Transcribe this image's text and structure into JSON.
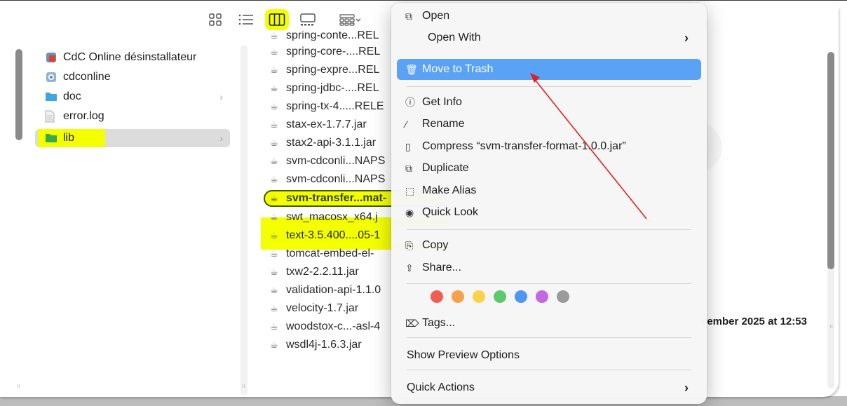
{
  "toolbar": {
    "views": [
      {
        "name": "icon-view",
        "active": false
      },
      {
        "name": "list-view",
        "active": false
      },
      {
        "name": "column-view",
        "active": true
      },
      {
        "name": "gallery-view",
        "active": false
      },
      {
        "name": "group-by",
        "active": false
      }
    ]
  },
  "sidebar": {
    "items": [
      {
        "label": "CdC Online désinstallateur",
        "icon": "app-icon",
        "chevron": false
      },
      {
        "label": "cdconline",
        "icon": "app-icon",
        "chevron": false
      },
      {
        "label": "doc",
        "icon": "folder-icon",
        "chevron": true
      },
      {
        "label": "error.log",
        "icon": "document-icon",
        "chevron": false
      },
      {
        "label": "lib",
        "icon": "folder-icon",
        "chevron": true,
        "selected": true
      }
    ],
    "chevron": "›"
  },
  "files": {
    "items": [
      "spring-conte...REL",
      "spring-core-....REL",
      "spring-expre...REL",
      "spring-jdbc-....REL",
      "spring-tx-4.....RELE",
      "stax-ex-1.7.7.jar",
      "stax2-api-3.1.1.jar",
      "svm-cdconli...NAPS",
      "svm-cdconli...NAPS",
      "svm-transfer...mat-",
      "swt_macosx_x64.j",
      "text-3.5.400....05-1",
      "tomcat-embed-el-",
      "txw2-2.2.11.jar",
      "validation-api-1.1.0",
      "velocity-1.7.jar",
      "woodstox-c...-asl-4",
      "wsdl4j-1.6.3.jar"
    ],
    "selected_index": 9
  },
  "menu": {
    "open": "Open",
    "open_with": "Open With",
    "move_to_trash": "Move to Trash",
    "get_info": "Get Info",
    "rename": "Rename",
    "compress": "Compress “svm-transfer-format-1.0.0.jar”",
    "duplicate": "Duplicate",
    "make_alias": "Make Alias",
    "quick_look": "Quick Look",
    "copy": "Copy",
    "share": "Share...",
    "tags": "Tags...",
    "show_preview_options": "Show Preview Options",
    "quick_actions": "Quick Actions",
    "submenu_chevron": "›",
    "tag_colors": [
      "#f25c54",
      "#f7a14a",
      "#f9d44a",
      "#5cc96a",
      "#4c97f5",
      "#c566e3",
      "#9b9b9b"
    ]
  },
  "preview": {
    "date_fragment": "cember 2025 at 12:53"
  },
  "colors": {
    "highlight": "#f4ff00",
    "menu_active": "#5aa2f5",
    "arrow": "#e02020"
  }
}
